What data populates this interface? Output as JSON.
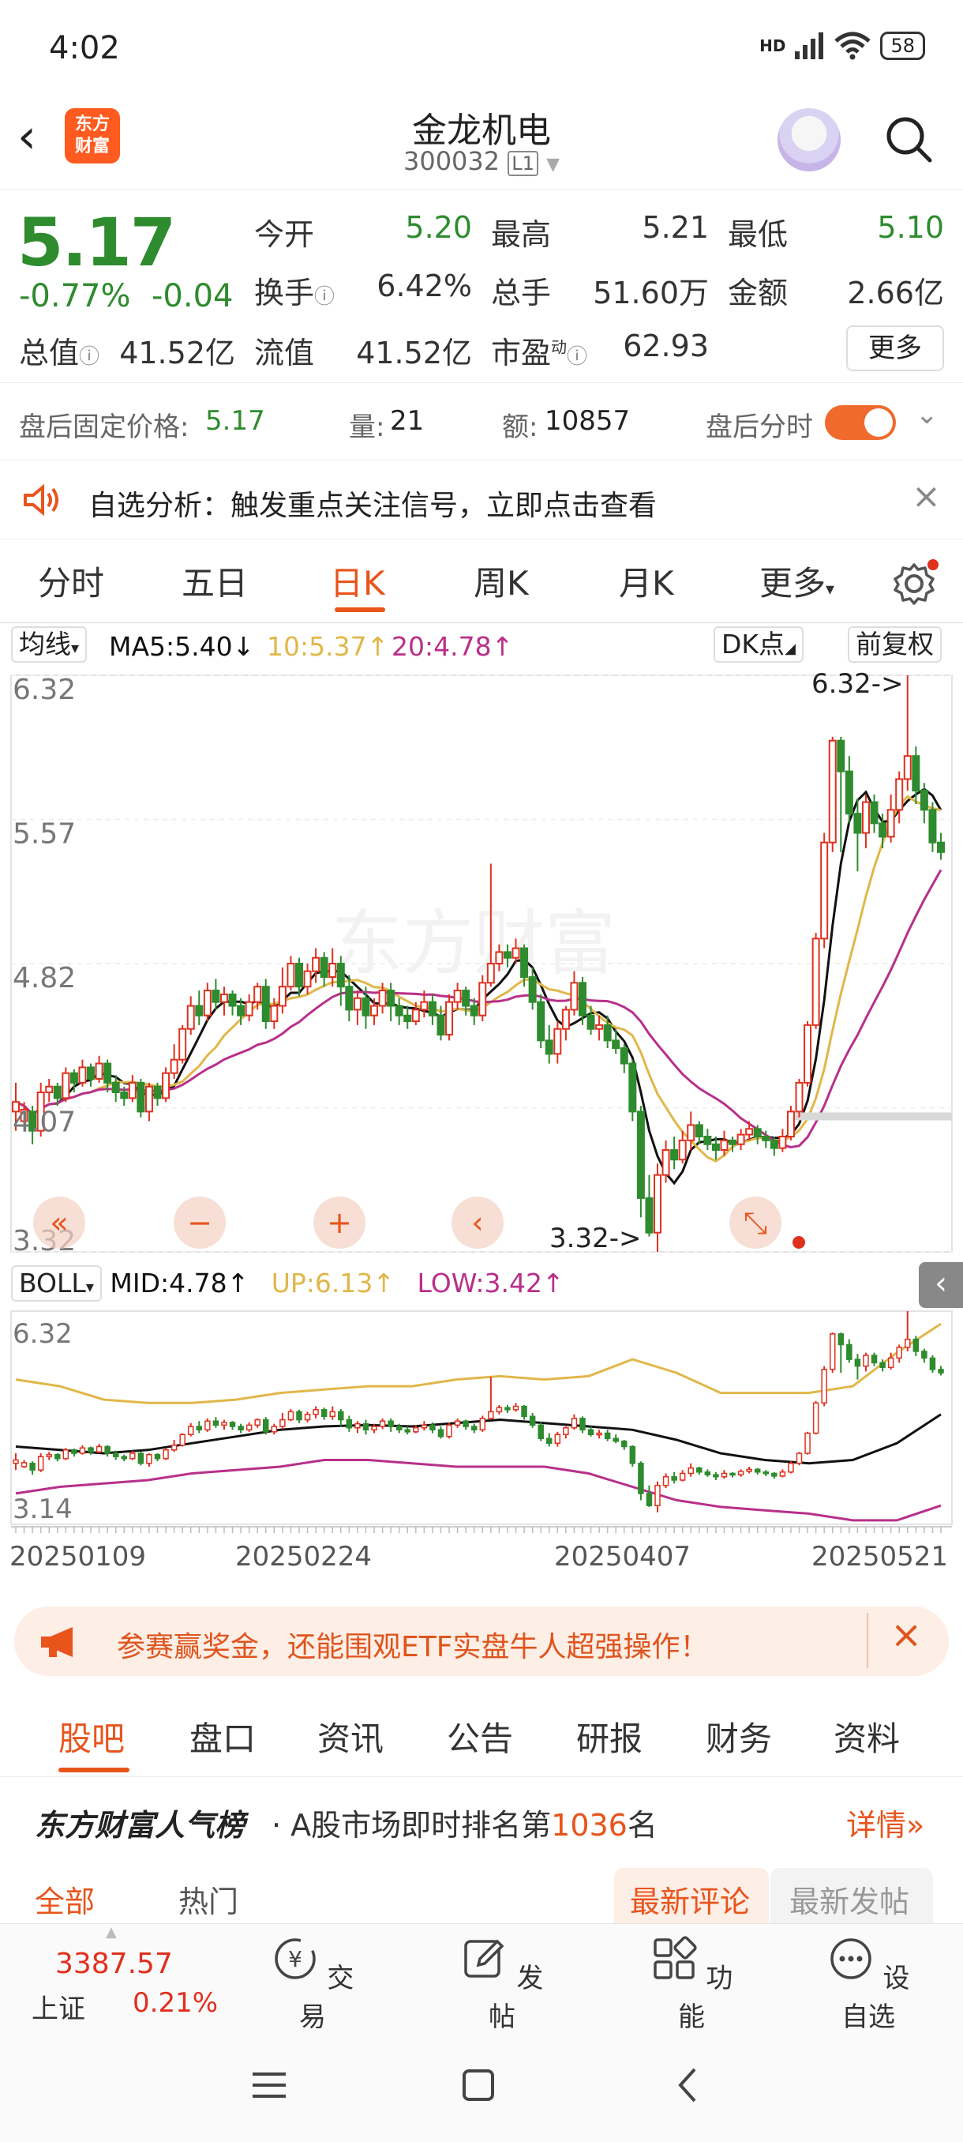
{
  "status": {
    "time": "4:02",
    "network": "HD",
    "battery": "58"
  },
  "header": {
    "stock_name": "金龙机电",
    "stock_code": "300032",
    "level": "L1",
    "logo_text": "东方财富"
  },
  "quote": {
    "price": "5.17",
    "change_pct": "-0.77%",
    "change": "-0.04",
    "open_label": "今开",
    "open": "5.20",
    "high_label": "最高",
    "high": "5.21",
    "low_label": "最低",
    "low": "5.10",
    "turnover_label": "换手",
    "turnover": "6.42%",
    "volume_label": "总手",
    "volume": "51.60万",
    "amount_label": "金额",
    "amount": "2.66亿",
    "mktcap_label": "总值",
    "mktcap": "41.52亿",
    "float_label": "流值",
    "float": "41.52亿",
    "pe_label": "市盈",
    "pe_sup": "动",
    "pe": "62.93",
    "more": "更多"
  },
  "afterhours": {
    "price_label": "盘后固定价格:",
    "price": "5.17",
    "vol_label": "量:",
    "vol": "21",
    "amt_label": "额:",
    "amt": "10857",
    "toggle_label": "盘后分时"
  },
  "alert": {
    "text": "自选分析：触发重点关注信号，立即点击查看"
  },
  "period_tabs": [
    "分时",
    "五日",
    "日K",
    "周K",
    "月K",
    "更多"
  ],
  "indicators": {
    "ma_toggle": "均线",
    "ma5": "MA5:5.40",
    "ma10": "10:5.37",
    "ma20": "20:4.78",
    "dk": "DK点",
    "adjust": "前复权",
    "boll": "BOLL",
    "mid": "MID:4.78",
    "up": "UP:6.13",
    "low": "LOW:3.42",
    "arrow_up": "↑",
    "arrow_down": "↓"
  },
  "colors": {
    "accent": "#e8541c",
    "up": "#e0301e",
    "down": "#2e8b2e",
    "ma5": "#111111",
    "ma10": "#e0b74a",
    "ma20": "#b8308a"
  },
  "chart_data": [
    {
      "type": "candlestick",
      "yticks": [
        "6.32",
        "5.57",
        "4.82",
        "4.07",
        "3.32"
      ],
      "ylim": [
        3.32,
        6.32
      ],
      "max_label": "6.32->",
      "min_label": "3.32->",
      "candles": [
        [
          4.05,
          4.1,
          3.95,
          4.2
        ],
        [
          4.0,
          4.06,
          3.98,
          4.1
        ],
        [
          4.05,
          3.95,
          3.88,
          4.08
        ],
        [
          3.95,
          4.15,
          3.92,
          4.2
        ],
        [
          4.15,
          4.18,
          4.1,
          4.22
        ],
        [
          4.18,
          4.12,
          4.08,
          4.2
        ],
        [
          4.12,
          4.25,
          4.1,
          4.28
        ],
        [
          4.25,
          4.2,
          4.15,
          4.27
        ],
        [
          4.2,
          4.28,
          4.18,
          4.32
        ],
        [
          4.28,
          4.22,
          4.18,
          4.3
        ],
        [
          4.22,
          4.3,
          4.2,
          4.34
        ],
        [
          4.3,
          4.2,
          4.15,
          4.32
        ],
        [
          4.2,
          4.15,
          4.1,
          4.24
        ],
        [
          4.15,
          4.12,
          4.08,
          4.18
        ],
        [
          4.12,
          4.2,
          4.1,
          4.24
        ],
        [
          4.2,
          4.05,
          4.02,
          4.22
        ],
        [
          4.05,
          4.18,
          4.0,
          4.2
        ],
        [
          4.18,
          4.12,
          4.08,
          4.2
        ],
        [
          4.12,
          4.25,
          4.1,
          4.28
        ],
        [
          4.25,
          4.32,
          4.22,
          4.4
        ],
        [
          4.32,
          4.48,
          4.3,
          4.5
        ],
        [
          4.48,
          4.6,
          4.45,
          4.65
        ],
        [
          4.6,
          4.55,
          4.5,
          4.68
        ],
        [
          4.55,
          4.68,
          4.52,
          4.72
        ],
        [
          4.68,
          4.62,
          4.58,
          4.74
        ],
        [
          4.62,
          4.66,
          4.55,
          4.7
        ],
        [
          4.66,
          4.6,
          4.55,
          4.68
        ],
        [
          4.6,
          4.55,
          4.5,
          4.64
        ],
        [
          4.55,
          4.62,
          4.52,
          4.66
        ],
        [
          4.62,
          4.7,
          4.58,
          4.72
        ],
        [
          4.7,
          4.52,
          4.48,
          4.74
        ],
        [
          4.52,
          4.6,
          4.48,
          4.64
        ],
        [
          4.6,
          4.7,
          4.56,
          4.8
        ],
        [
          4.7,
          4.82,
          4.68,
          4.86
        ],
        [
          4.82,
          4.7,
          4.65,
          4.85
        ],
        [
          4.7,
          4.78,
          4.66,
          4.82
        ],
        [
          4.78,
          4.85,
          4.72,
          4.9
        ],
        [
          4.85,
          4.75,
          4.7,
          4.88
        ],
        [
          4.75,
          4.82,
          4.7,
          4.9
        ],
        [
          4.82,
          4.7,
          4.6,
          4.86
        ],
        [
          4.7,
          4.58,
          4.52,
          4.76
        ],
        [
          4.58,
          4.64,
          4.5,
          4.68
        ],
        [
          4.64,
          4.55,
          4.48,
          4.7
        ],
        [
          4.55,
          4.6,
          4.5,
          4.64
        ],
        [
          4.6,
          4.68,
          4.56,
          4.72
        ],
        [
          4.68,
          4.6,
          4.52,
          4.72
        ],
        [
          4.6,
          4.55,
          4.5,
          4.64
        ],
        [
          4.55,
          4.52,
          4.48,
          4.6
        ],
        [
          4.52,
          4.58,
          4.5,
          4.62
        ],
        [
          4.58,
          4.62,
          4.54,
          4.68
        ],
        [
          4.62,
          4.55,
          4.5,
          4.66
        ],
        [
          4.55,
          4.45,
          4.42,
          4.6
        ],
        [
          4.45,
          4.62,
          4.42,
          4.66
        ],
        [
          4.62,
          4.68,
          4.58,
          4.72
        ],
        [
          4.68,
          4.6,
          4.55,
          4.7
        ],
        [
          4.6,
          4.55,
          4.5,
          4.64
        ],
        [
          4.55,
          4.72,
          4.52,
          4.76
        ],
        [
          4.72,
          4.82,
          4.7,
          5.34
        ],
        [
          4.82,
          4.88,
          4.78,
          4.92
        ],
        [
          4.88,
          4.85,
          4.8,
          4.92
        ],
        [
          4.85,
          4.9,
          4.82,
          4.95
        ],
        [
          4.9,
          4.75,
          4.7,
          4.92
        ],
        [
          4.75,
          4.62,
          4.58,
          4.8
        ],
        [
          4.62,
          4.42,
          4.38,
          4.66
        ],
        [
          4.42,
          4.35,
          4.3,
          4.5
        ],
        [
          4.35,
          4.48,
          4.3,
          4.52
        ],
        [
          4.48,
          4.58,
          4.42,
          4.6
        ],
        [
          4.58,
          4.72,
          4.55,
          4.78
        ],
        [
          4.72,
          4.55,
          4.5,
          4.75
        ],
        [
          4.55,
          4.48,
          4.45,
          4.6
        ],
        [
          4.48,
          4.5,
          4.42,
          4.55
        ],
        [
          4.5,
          4.42,
          4.38,
          4.55
        ],
        [
          4.42,
          4.38,
          4.35,
          4.48
        ],
        [
          4.38,
          4.3,
          4.25,
          4.4
        ],
        [
          4.3,
          4.05,
          4.0,
          4.32
        ],
        [
          4.05,
          3.6,
          3.5,
          4.08
        ],
        [
          3.6,
          3.42,
          3.4,
          3.72
        ],
        [
          3.42,
          3.72,
          3.32,
          3.78
        ],
        [
          3.72,
          3.85,
          3.68,
          3.9
        ],
        [
          3.85,
          3.8,
          3.75,
          3.92
        ],
        [
          3.8,
          3.9,
          3.78,
          3.95
        ],
        [
          3.9,
          3.98,
          3.85,
          4.05
        ],
        [
          3.98,
          3.92,
          3.88,
          4.0
        ],
        [
          3.92,
          3.88,
          3.85,
          3.96
        ],
        [
          3.88,
          3.85,
          3.8,
          3.92
        ],
        [
          3.85,
          3.9,
          3.82,
          3.95
        ],
        [
          3.9,
          3.88,
          3.84,
          3.92
        ],
        [
          3.88,
          3.93,
          3.85,
          3.96
        ],
        [
          3.93,
          3.96,
          3.9,
          4.0
        ],
        [
          3.96,
          3.92,
          3.88,
          3.98
        ],
        [
          3.92,
          3.9,
          3.86,
          3.95
        ],
        [
          3.9,
          3.86,
          3.82,
          3.92
        ],
        [
          3.86,
          3.92,
          3.84,
          3.96
        ],
        [
          3.92,
          4.05,
          3.9,
          4.08
        ],
        [
          4.05,
          4.2,
          4.02,
          4.22
        ],
        [
          4.2,
          4.5,
          4.18,
          4.52
        ],
        [
          4.5,
          4.95,
          4.48,
          4.98
        ],
        [
          4.95,
          5.45,
          4.9,
          5.5
        ],
        [
          5.45,
          5.98,
          5.4,
          6.0
        ],
        [
          5.98,
          5.82,
          5.4,
          6.0
        ],
        [
          5.82,
          5.6,
          5.55,
          5.9
        ],
        [
          5.6,
          5.5,
          5.3,
          5.68
        ],
        [
          5.5,
          5.66,
          5.42,
          5.7
        ],
        [
          5.66,
          5.55,
          5.5,
          5.7
        ],
        [
          5.55,
          5.48,
          5.42,
          5.6
        ],
        [
          5.48,
          5.62,
          5.45,
          5.7
        ],
        [
          5.62,
          5.78,
          5.55,
          5.82
        ],
        [
          5.78,
          5.9,
          5.72,
          6.32
        ],
        [
          5.9,
          5.72,
          5.65,
          5.95
        ],
        [
          5.72,
          5.62,
          5.55,
          5.76
        ],
        [
          5.62,
          5.45,
          5.4,
          5.66
        ],
        [
          5.45,
          5.4,
          5.36,
          5.5
        ]
      ],
      "ma5_label": "MA5",
      "ma10_label": "10",
      "ma20_label": "20"
    },
    {
      "type": "line",
      "panel": "BOLL",
      "yticks": [
        "6.32",
        "3.14"
      ],
      "ylim": [
        3.14,
        6.32
      ],
      "series": [
        {
          "name": "UP",
          "values": [
            5.3,
            5.2,
            5.0,
            4.95,
            4.95,
            5.0,
            5.1,
            5.15,
            5.2,
            5.2,
            5.3,
            5.35,
            5.3,
            5.35,
            5.6,
            5.4,
            5.1,
            5.1,
            5.1,
            5.2,
            5.7,
            6.13
          ]
        },
        {
          "name": "MID",
          "values": [
            4.3,
            4.25,
            4.2,
            4.25,
            4.35,
            4.45,
            4.55,
            4.6,
            4.62,
            4.6,
            4.65,
            4.7,
            4.65,
            4.6,
            4.55,
            4.4,
            4.2,
            4.1,
            4.05,
            4.1,
            4.35,
            4.78
          ]
        },
        {
          "name": "LOW",
          "values": [
            3.6,
            3.7,
            3.75,
            3.8,
            3.9,
            3.95,
            4.0,
            4.1,
            4.1,
            4.05,
            4.0,
            4.0,
            4.0,
            3.9,
            3.7,
            3.5,
            3.4,
            3.35,
            3.3,
            3.2,
            3.2,
            3.42
          ]
        }
      ]
    }
  ],
  "date_axis": [
    "20250109",
    "20250224",
    "20250407",
    "20250521"
  ],
  "banner": {
    "text": "参赛赢奖金，还能围观ETF实盘牛人超强操作！"
  },
  "stock_tabs": [
    "股吧",
    "盘口",
    "资讯",
    "公告",
    "研报",
    "财务",
    "资料"
  ],
  "rank": {
    "title": "东方财富人气榜",
    "text_prefix": "· A股市场即时排名第",
    "rank": "1036",
    "text_suffix": "名",
    "detail": "详情"
  },
  "filters": {
    "all": "全部",
    "hot": "热门",
    "latest_comment": "最新评论",
    "latest_post": "最新发帖"
  },
  "bottom": {
    "index_value": "3387.57",
    "index_name": "上证",
    "index_pct": "0.21%",
    "trade": "交易",
    "post": "发帖",
    "functions": "功能",
    "set_watch": "设自选"
  }
}
